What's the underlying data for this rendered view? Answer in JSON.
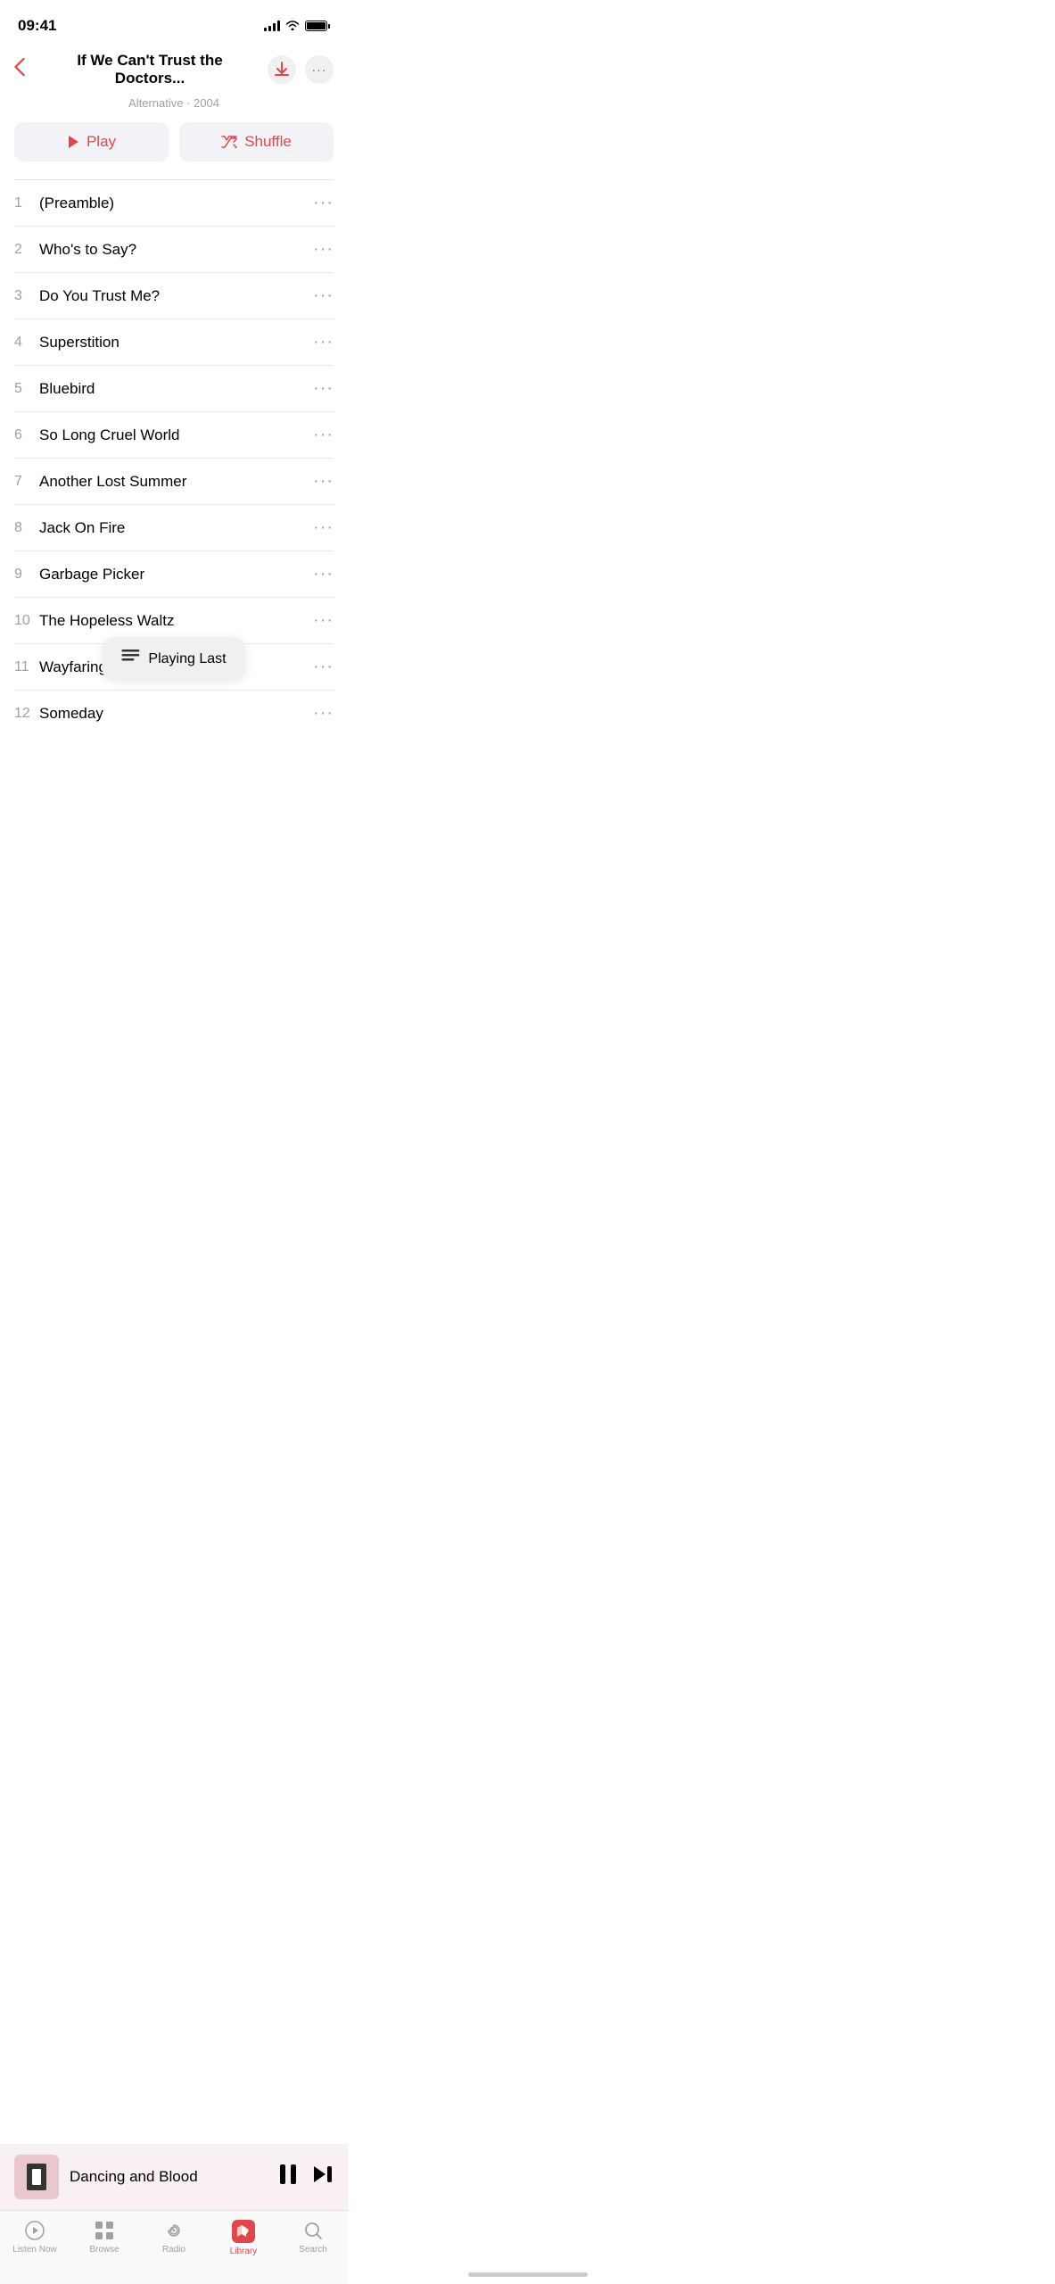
{
  "statusBar": {
    "time": "09:41"
  },
  "header": {
    "title": "If We Can't Trust the Doctors...",
    "subtitle": "Alternative · 2004"
  },
  "buttons": {
    "play": "▶  Play",
    "shuffle": "⇄  Shuffle"
  },
  "tracks": [
    {
      "number": "1",
      "title": "(Preamble)"
    },
    {
      "number": "2",
      "title": "Who's to Say?"
    },
    {
      "number": "3",
      "title": "Do You Trust Me?"
    },
    {
      "number": "4",
      "title": "Superstition"
    },
    {
      "number": "5",
      "title": "Bluebird"
    },
    {
      "number": "6",
      "title": "So Long Cruel World"
    },
    {
      "number": "7",
      "title": "Another Lost Summer"
    },
    {
      "number": "8",
      "title": "Jack On Fire"
    },
    {
      "number": "9",
      "title": "Garbage Picker"
    },
    {
      "number": "10",
      "title": "The Hopeless Waltz"
    },
    {
      "number": "11",
      "title": "Wayfaring Str…"
    },
    {
      "number": "12",
      "title": "Someday"
    }
  ],
  "tooltip": {
    "label": "Playing Last"
  },
  "nowPlaying": {
    "title": "Dancing and Blood"
  },
  "tabBar": {
    "items": [
      {
        "label": "Listen Now",
        "icon": "▶"
      },
      {
        "label": "Browse",
        "icon": "⊞"
      },
      {
        "label": "Radio",
        "icon": "((·))"
      },
      {
        "label": "Library",
        "icon": "♪"
      },
      {
        "label": "Search",
        "icon": "⌕"
      }
    ]
  }
}
